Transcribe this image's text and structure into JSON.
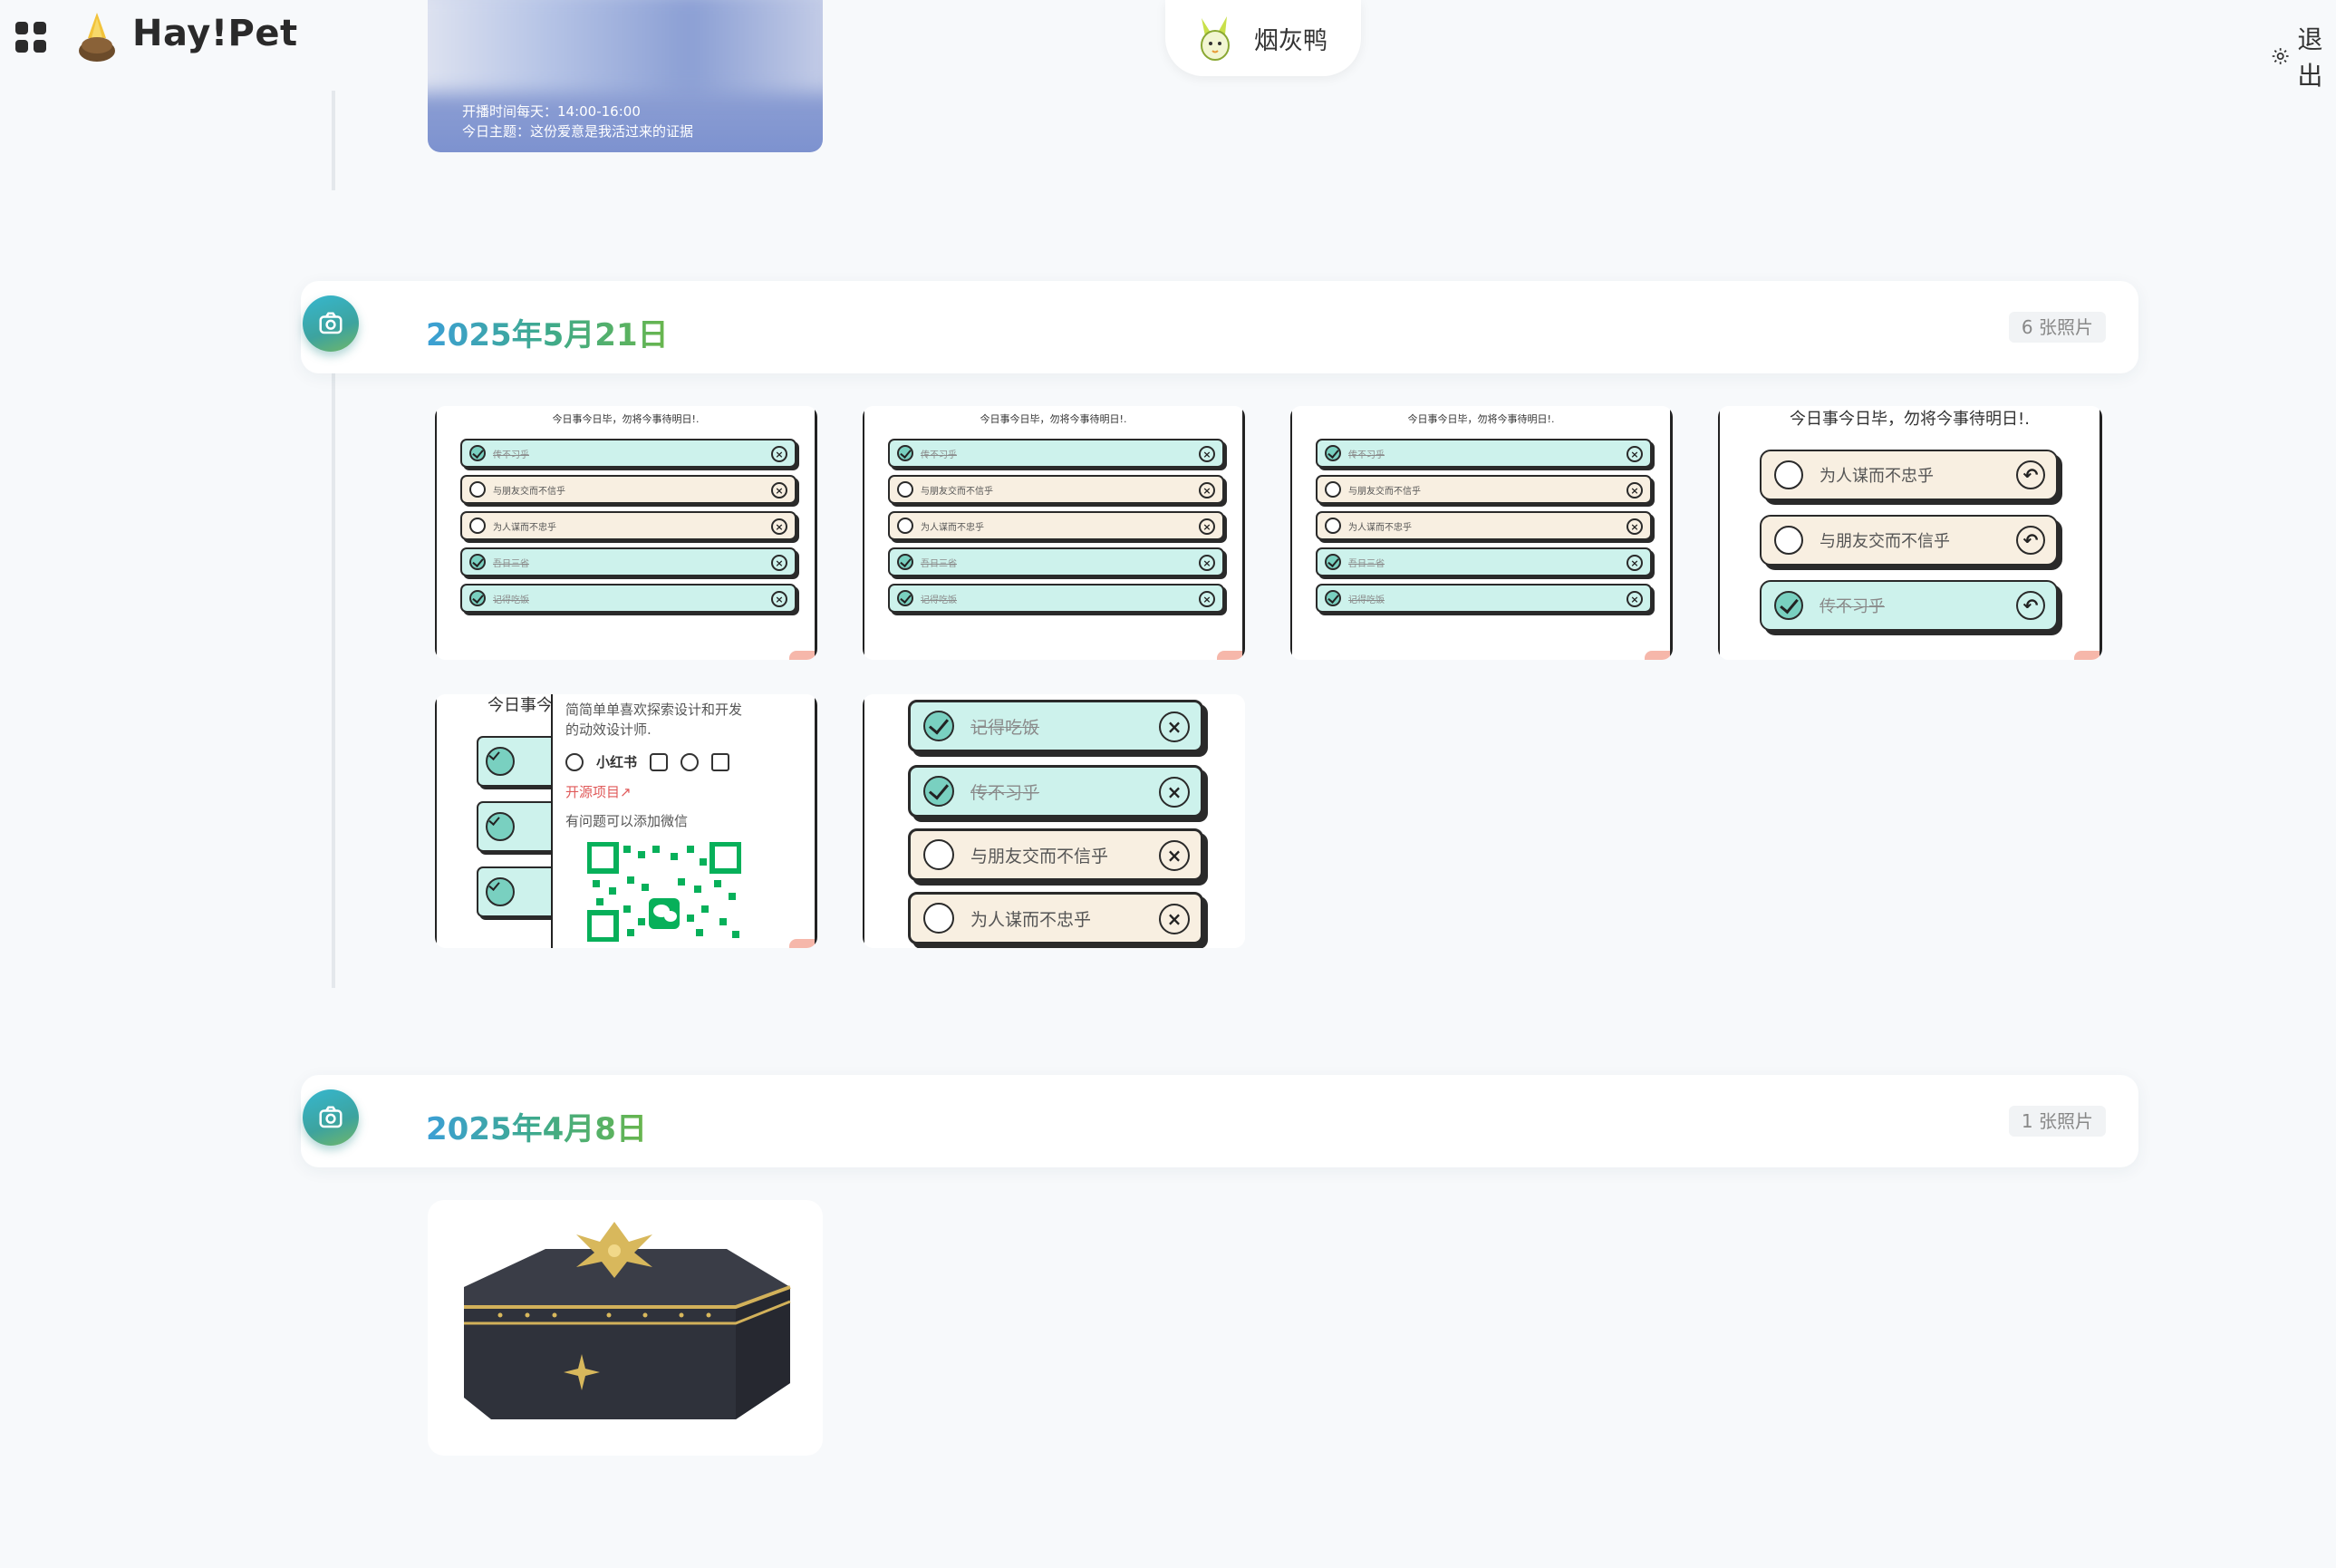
{
  "header": {
    "app_title": "Hay!Pet",
    "user_name": "烟灰鸭",
    "settings_label": "退出"
  },
  "stream": {
    "time_line": "开播时间每天：14:00-16:00",
    "theme_line": "今日主题：这份爱意是我活过来的证据"
  },
  "groups": [
    {
      "date": "2025年5月21日",
      "count": "6 张照片"
    },
    {
      "date": "2025年4月8日",
      "count": "1 张照片"
    }
  ],
  "checklist": {
    "header": "今日事今日毕，勿将今事待明日!.",
    "items": [
      {
        "text": "传不习乎",
        "done": true
      },
      {
        "text": "与朋友交而不信乎",
        "done": false
      },
      {
        "text": "为人谋而不忠乎",
        "done": false
      },
      {
        "text": "吾日三省",
        "done": true
      },
      {
        "text": "记得吃饭",
        "done": true
      }
    ]
  },
  "checklist_big": {
    "header": "今日事今日毕，勿将今事待明日!.",
    "items": [
      {
        "text": "为人谋而不忠乎",
        "done": false
      },
      {
        "text": "与朋友交而不信乎",
        "done": false
      },
      {
        "text": "传不习乎",
        "done": true
      }
    ]
  },
  "checklist_zoom": {
    "items": [
      {
        "text": "记得吃饭",
        "done": true
      },
      {
        "text": "传不习乎",
        "done": true
      },
      {
        "text": "与朋友交而不信乎",
        "done": false
      },
      {
        "text": "为人谋而不忠乎",
        "done": false
      }
    ]
  },
  "popup": {
    "header_partial": "今日事今",
    "bio": "简简单单喜欢探索设计和开发的动效设计师.",
    "xiaohongshu": "小红书",
    "open_source": "开源项目↗",
    "add_wechat": "有问题可以添加微信"
  },
  "colors": {
    "accent_start": "#3c9fd6",
    "accent_end": "#69b64c",
    "task_done_bg": "#cdf2ec",
    "task_todo_bg": "#f8efe1"
  }
}
